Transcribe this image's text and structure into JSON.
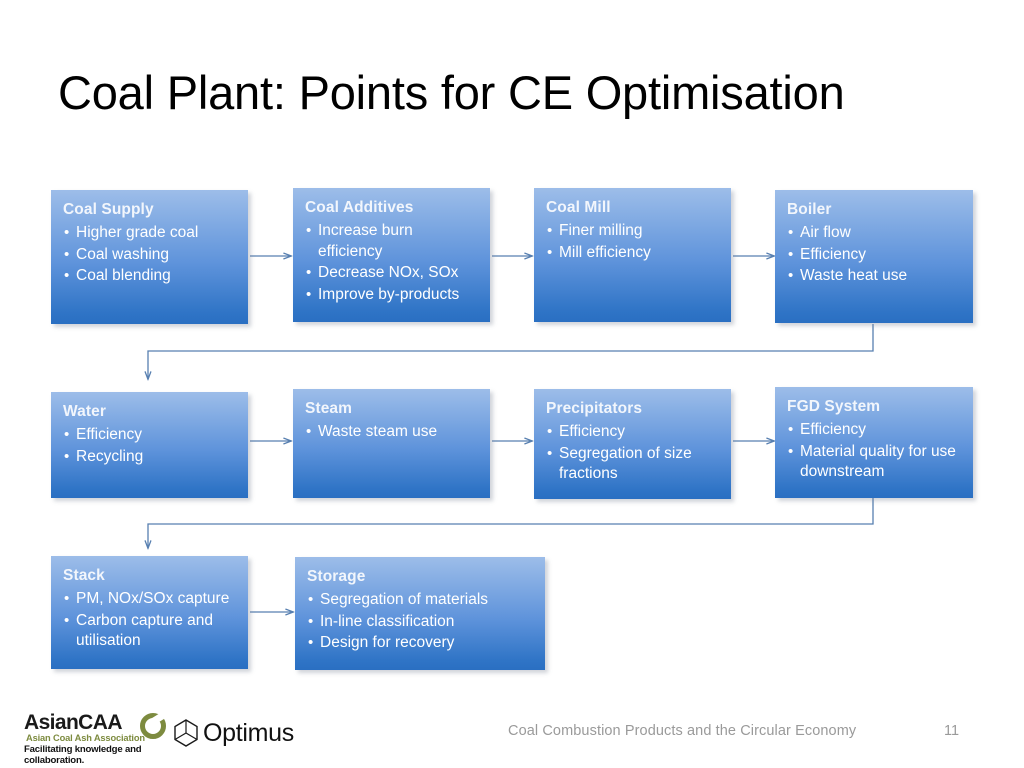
{
  "slide": {
    "title": "Coal Plant: Points for CE Optimisation",
    "accent_color": "#3b7dd8",
    "box_gradient_top": "#9dbde9",
    "box_gradient_bottom": "#2a6fc2",
    "connector_color": "#577fb0"
  },
  "boxes": [
    {
      "id": "coal-supply",
      "title": "Coal Supply",
      "items": [
        "Higher grade coal",
        "Coal washing",
        "Coal blending"
      ]
    },
    {
      "id": "coal-additives",
      "title": "Coal Additives",
      "items": [
        "Increase burn efficiency",
        "Decrease NOx, SOx",
        "Improve by-products"
      ]
    },
    {
      "id": "coal-mill",
      "title": "Coal Mill",
      "items": [
        "Finer milling",
        "Mill efficiency"
      ]
    },
    {
      "id": "boiler",
      "title": "Boiler",
      "items": [
        "Air flow",
        "Efficiency",
        "Waste heat use"
      ]
    },
    {
      "id": "water",
      "title": "Water",
      "items": [
        "Efficiency",
        "Recycling"
      ]
    },
    {
      "id": "steam",
      "title": "Steam",
      "items": [
        "Waste steam use"
      ]
    },
    {
      "id": "precipitators",
      "title": "Precipitators",
      "items": [
        "Efficiency",
        "Segregation of size fractions"
      ]
    },
    {
      "id": "fgd-system",
      "title": "FGD System",
      "items": [
        "Efficiency",
        "Material quality for use downstream"
      ]
    },
    {
      "id": "stack",
      "title": "Stack",
      "items": [
        "PM, NOx/SOx capture",
        "Carbon capture and utilisation"
      ]
    },
    {
      "id": "storage",
      "title": "Storage",
      "items": [
        "Segregation of materials",
        "In-line classification",
        "Design for recovery"
      ]
    }
  ],
  "footer": {
    "text": "Coal Combustion Products and the Circular Economy",
    "page_number": "11"
  },
  "logos": {
    "asiancaa": {
      "wordmark": "AsianCAA",
      "subtitle": "Asian Coal Ash Association",
      "tagline": "Facilitating knowledge and collaboration.",
      "ring_color": "#7d8b3f"
    },
    "optimus": {
      "wordmark": "Optimus"
    }
  }
}
